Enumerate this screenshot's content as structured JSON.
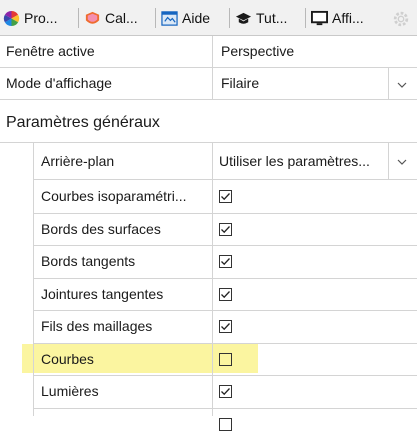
{
  "tabs": [
    {
      "label": "Pro...",
      "icon": "color-wheel-icon"
    },
    {
      "label": "Cal...",
      "icon": "layers-icon"
    },
    {
      "label": "Aide",
      "icon": "help-icon"
    },
    {
      "label": "Tut...",
      "icon": "graduation-cap-icon"
    },
    {
      "label": "Affi...",
      "icon": "monitor-icon"
    }
  ],
  "settings_icon": "gear-icon",
  "properties": [
    {
      "label": "Fenêtre active",
      "value": "Perspective"
    },
    {
      "label": "Mode d'affichage",
      "value": "Filaire"
    }
  ],
  "section_title": "Paramètres généraux",
  "general": {
    "background_label": "Arrière-plan",
    "background_value": "Utiliser les paramètres...",
    "items": [
      {
        "label": "Courbes isoparamétri...",
        "checked": true
      },
      {
        "label": "Bords des surfaces",
        "checked": true
      },
      {
        "label": "Bords tangents",
        "checked": true
      },
      {
        "label": "Jointures tangentes",
        "checked": true
      },
      {
        "label": "Fils des maillages",
        "checked": true
      },
      {
        "label": "Courbes",
        "checked": false,
        "highlighted": true
      },
      {
        "label": "Lumières",
        "checked": true
      }
    ]
  },
  "colors": {
    "highlight": "#fbf5a0",
    "accent_blue": "#1565c0"
  }
}
